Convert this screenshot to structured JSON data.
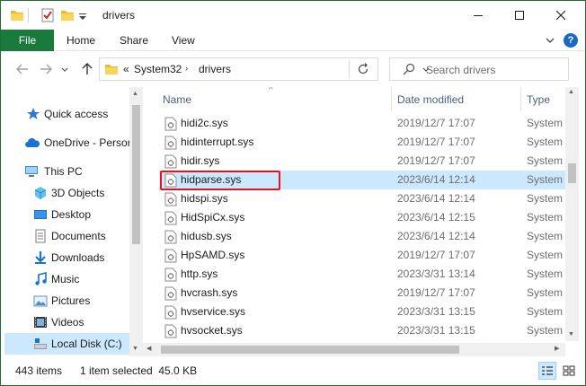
{
  "window": {
    "title": "drivers",
    "accent": "#1a7a3c"
  },
  "ribbon": {
    "tabs": [
      "File",
      "Home",
      "Share",
      "View"
    ],
    "help_label": "?"
  },
  "address": {
    "overflow": "«",
    "crumbs": [
      "System32",
      "drivers"
    ],
    "search_placeholder": "Search drivers"
  },
  "nav": {
    "items": [
      {
        "label": "Quick access",
        "icon": "star-icon"
      },
      {
        "label": "OneDrive - Persor",
        "icon": "cloud-icon"
      },
      {
        "label": "This PC",
        "icon": "computer-icon"
      },
      {
        "label": "3D Objects",
        "icon": "cube-icon"
      },
      {
        "label": "Desktop",
        "icon": "desktop-icon"
      },
      {
        "label": "Documents",
        "icon": "document-icon"
      },
      {
        "label": "Downloads",
        "icon": "download-icon"
      },
      {
        "label": "Music",
        "icon": "music-icon"
      },
      {
        "label": "Pictures",
        "icon": "picture-icon"
      },
      {
        "label": "Videos",
        "icon": "video-icon"
      },
      {
        "label": "Local Disk (C:)",
        "icon": "drive-icon"
      }
    ]
  },
  "files": {
    "columns": {
      "name": "Name",
      "date": "Date modified",
      "type": "Type"
    },
    "rows": [
      {
        "name": "hidi2c.sys",
        "date": "2019/12/7 17:07",
        "type": "System file"
      },
      {
        "name": "hidinterrupt.sys",
        "date": "2019/12/7 17:07",
        "type": "System file"
      },
      {
        "name": "hidir.sys",
        "date": "2019/12/7 17:07",
        "type": "System file"
      },
      {
        "name": "hidparse.sys",
        "date": "2023/6/14 12:14",
        "type": "System file"
      },
      {
        "name": "hidspi.sys",
        "date": "2023/6/14 12:14",
        "type": "System file"
      },
      {
        "name": "HidSpiCx.sys",
        "date": "2023/6/14 12:15",
        "type": "System file"
      },
      {
        "name": "hidusb.sys",
        "date": "2023/6/14 12:14",
        "type": "System file"
      },
      {
        "name": "HpSAMD.sys",
        "date": "2019/12/7 17:07",
        "type": "System file"
      },
      {
        "name": "http.sys",
        "date": "2023/3/31 13:14",
        "type": "System file"
      },
      {
        "name": "hvcrash.sys",
        "date": "2019/12/7 17:07",
        "type": "System file"
      },
      {
        "name": "hvservice.sys",
        "date": "2023/3/31 13:15",
        "type": "System file"
      },
      {
        "name": "hvsocket.sys",
        "date": "2023/3/31 13:15",
        "type": "System file"
      }
    ]
  },
  "status": {
    "count": "443 items",
    "selection": "1 item selected  45.0 KB"
  }
}
